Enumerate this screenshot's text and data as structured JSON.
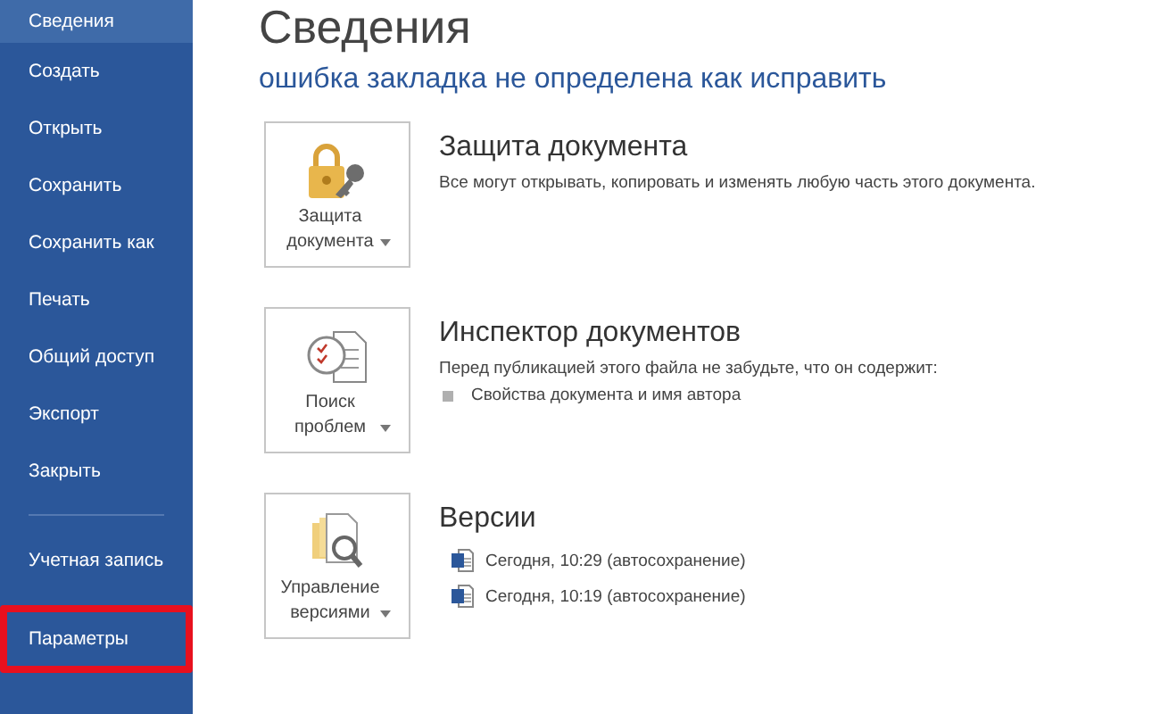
{
  "sidebar": {
    "items": [
      {
        "label": "Сведения",
        "selected": true,
        "highlighted": false
      },
      {
        "label": "Создать",
        "selected": false,
        "highlighted": false
      },
      {
        "label": "Открыть",
        "selected": false,
        "highlighted": false
      },
      {
        "label": "Сохранить",
        "selected": false,
        "highlighted": false
      },
      {
        "label": "Сохранить как",
        "selected": false,
        "highlighted": false
      },
      {
        "label": "Печать",
        "selected": false,
        "highlighted": false
      },
      {
        "label": "Общий доступ",
        "selected": false,
        "highlighted": false
      },
      {
        "label": "Экспорт",
        "selected": false,
        "highlighted": false
      },
      {
        "label": "Закрыть",
        "selected": false,
        "highlighted": false
      },
      {
        "kind": "divider"
      },
      {
        "label": "Учетная запись",
        "selected": false,
        "highlighted": false
      },
      {
        "label": "Параметры",
        "selected": false,
        "highlighted": true
      }
    ]
  },
  "page": {
    "title": "Сведения",
    "subtitle": "ошибка закладка не определена как исправить"
  },
  "sections": [
    {
      "button": "Защита документа",
      "heading": "Защита документа",
      "description": "Все могут открывать, копировать и изменять любую часть этого документа."
    },
    {
      "button": "Поиск проблем",
      "heading": "Инспектор документов",
      "description": "Перед публикацией этого файла не забудьте, что он содержит:",
      "bullets": [
        "Свойства документа и имя автора"
      ]
    },
    {
      "button": "Управление версиями",
      "heading": "Версии",
      "versions": [
        "Сегодня, 10:29 (автосохранение)",
        "Сегодня, 10:19 (автосохранение)"
      ]
    }
  ]
}
